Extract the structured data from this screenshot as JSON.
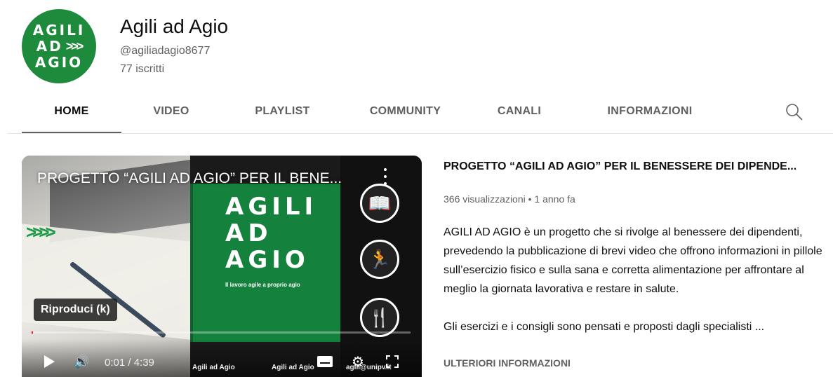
{
  "channel": {
    "avatar_lines": [
      "AGILI",
      "AD",
      "AGIO"
    ],
    "avatar_arrows": ">>>",
    "name": "Agili ad Agio",
    "handle": "@agiliadagio8677",
    "subscribers": "77 iscritti"
  },
  "tabs": [
    {
      "label": "HOME",
      "active": true
    },
    {
      "label": "VIDEO"
    },
    {
      "label": "PLAYLIST"
    },
    {
      "label": "COMMUNITY"
    },
    {
      "label": "CANALI"
    },
    {
      "label": "INFORMAZIONI"
    }
  ],
  "player": {
    "overlay_title": "PROGETTO “AGILI AD AGIO” PER IL BENE...",
    "slide_lines": [
      "AGILI",
      "AD",
      "AGIO"
    ],
    "slide_subtitle": "Il lavoro agile a proprio agio",
    "tooltip": "Riproduci (k)",
    "time": "0:01 / 4:39",
    "progress_fraction": 0.004,
    "watermark_channel": "Agili ad Agio",
    "watermark_facebook": "Agili ad Agio",
    "watermark_email": "agili@unipv.it"
  },
  "video": {
    "title": "PROGETTO “AGILI AD AGIO” PER IL BENESSERE DEI DIPENDE...",
    "meta": "366 visualizzazioni • 1 anno fa",
    "description_p1": "AGILI AD AGIO è un progetto che si rivolge al benessere dei dipendenti, prevedendo la pubblicazione di brevi video che offrono informazioni in pillole sull’esercizio fisico e sulla sana e corretta alimentazione per affrontare al meglio la giornata lavorativa e restare in salute.",
    "description_p2": "Gli esercizi e i consigli sono pensati e proposti dagli specialisti ...",
    "more_info": "ULTERIORI INFORMAZIONI"
  },
  "colors": {
    "brand_green": "#1e8a3c",
    "text_primary": "#0f0f0f",
    "text_secondary": "#606060",
    "progress_red": "#ff0000"
  }
}
